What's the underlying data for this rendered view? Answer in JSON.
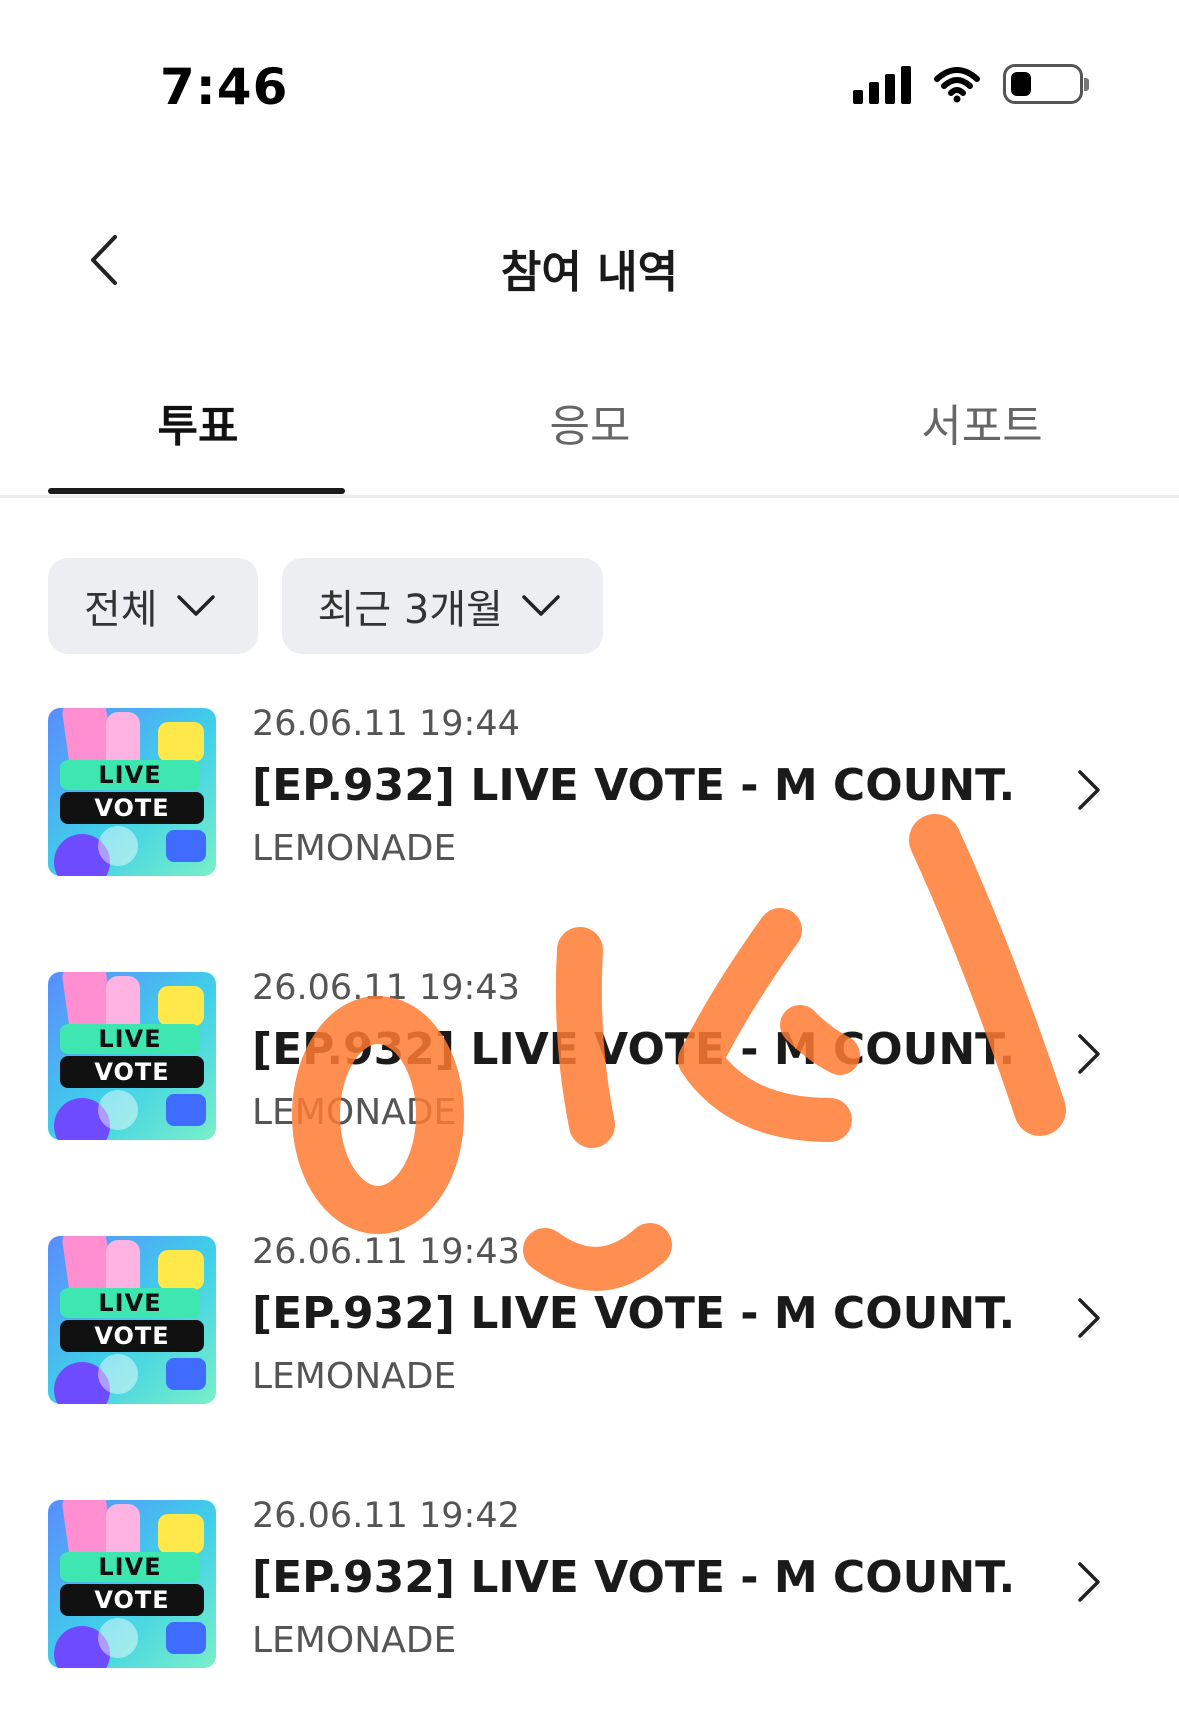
{
  "status_bar": {
    "time": "7:46",
    "icons": [
      "signal-icon",
      "wifi-icon",
      "battery-icon"
    ]
  },
  "header": {
    "title": "참여 내역",
    "back_icon": "chevron-left-icon"
  },
  "tabs": [
    {
      "label": "투표",
      "active": true
    },
    {
      "label": "응모",
      "active": false
    },
    {
      "label": "서포트",
      "active": false
    }
  ],
  "filters": [
    {
      "label": "전체"
    },
    {
      "label": "최근 3개월"
    }
  ],
  "thumbnail": {
    "line1": "LIVE",
    "line2": "VOTE"
  },
  "items": [
    {
      "date": "26.06.11 19:44",
      "title": "[EP.932] LIVE VOTE - M COUNT...",
      "artist": "LEMONADE"
    },
    {
      "date": "26.06.11 19:43",
      "title": "[EP.932] LIVE VOTE - M COUNT...",
      "artist": "LEMONADE"
    },
    {
      "date": "26.06.11 19:43",
      "title": "[EP.932] LIVE VOTE - M COUNT...",
      "artist": "LEMONADE"
    },
    {
      "date": "26.06.11 19:42",
      "title": "[EP.932] LIVE VOTE - M COUNT...",
      "artist": "LEMONADE"
    }
  ],
  "colors": {
    "accent": "#1a1a1a",
    "chip_bg": "#eceef2",
    "scribble": "#ff7a33"
  }
}
